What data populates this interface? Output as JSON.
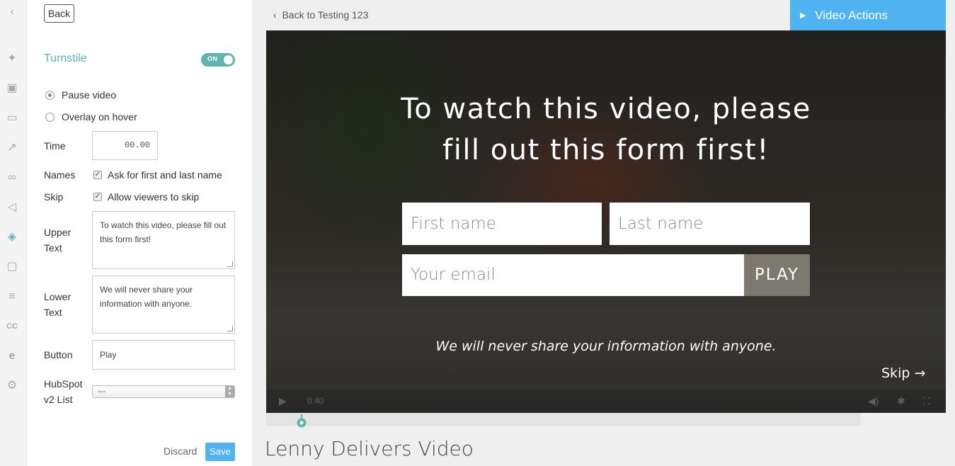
{
  "rail": {
    "icons": [
      "chevron-left-icon",
      "magic-wand-icon",
      "image-icon",
      "monitor-icon",
      "share-icon",
      "link-icon",
      "megaphone-icon",
      "ticket-icon",
      "lock-icon",
      "list-icon",
      "closed-caption-icon",
      "e-logo-icon",
      "hubspot-icon"
    ]
  },
  "panel": {
    "back_label": "Back",
    "turnstile_label": "Turnstile",
    "toggle_label": "ON",
    "radio_pause": "Pause video",
    "radio_overlay": "Overlay on hover",
    "time_label": "Time",
    "time_value": "00.00",
    "names_label": "Names",
    "names_check": "Ask for first and last name",
    "skip_label": "Skip",
    "skip_check": "Allow viewers to skip",
    "upper_label_1": "Upper",
    "upper_label_2": "Text",
    "upper_text": "To watch this video, please fill out this form first!",
    "lower_label_1": "Lower",
    "lower_label_2": "Text",
    "lower_text": "We will never share your information with anyone.",
    "button_label": "Button",
    "button_value": "Play",
    "hubspot_label_1": "HubSpot",
    "hubspot_label_2": "v2 List",
    "hubspot_value": "---",
    "discard_label": "Discard",
    "save_label": "Save"
  },
  "main": {
    "back_link": "Back to Testing 123",
    "video_actions": "Video Actions",
    "gate_title_1": "To watch this video, please",
    "gate_title_2": "fill out this form first!",
    "first_name_placeholder": "First name",
    "last_name_placeholder": "Last name",
    "email_placeholder": "Your email",
    "play_label": "PLAY",
    "lower_text": "We will never share your information with anyone.",
    "skip_label": "Skip →",
    "time_display": "0:40",
    "video_title": "Lenny Delivers Video"
  },
  "colors": {
    "accent_teal": "#5fb5ae",
    "accent_blue": "#4eb3f0",
    "play_button": "#7c7a70"
  }
}
